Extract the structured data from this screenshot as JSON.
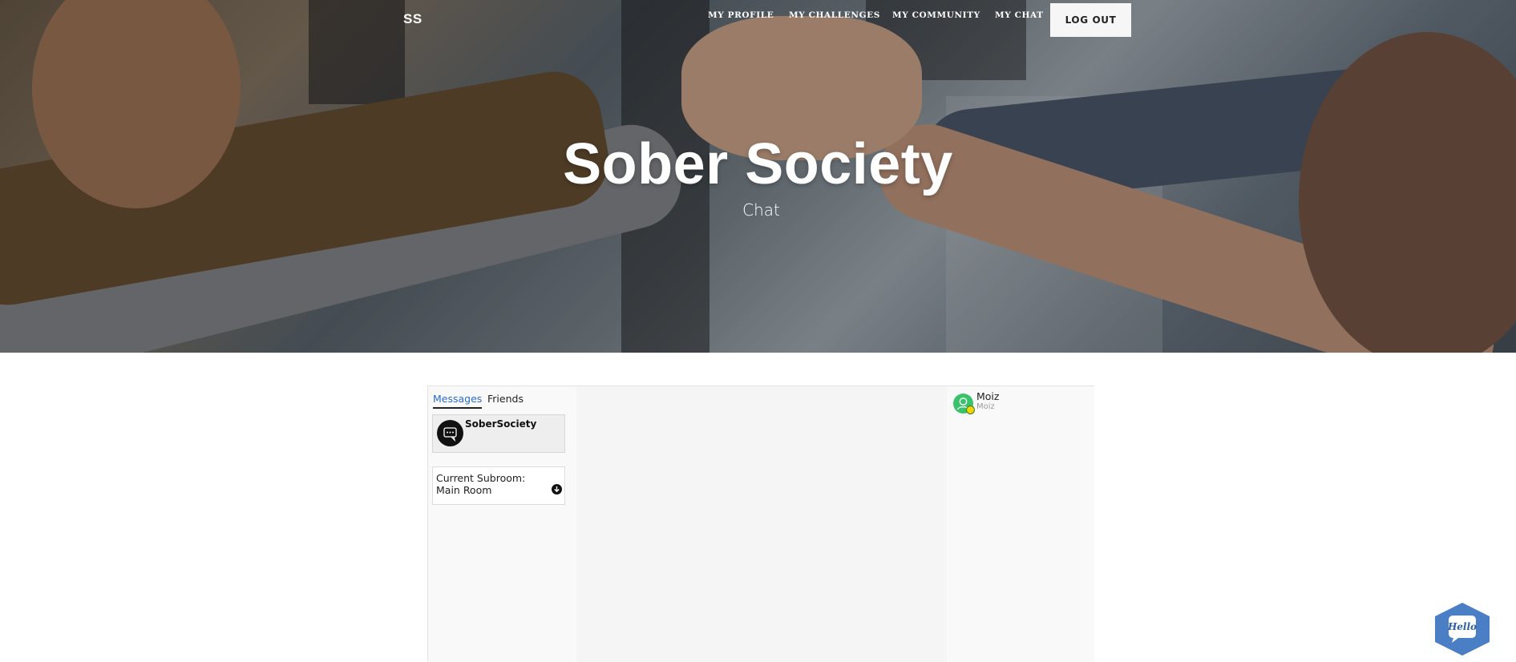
{
  "nav": {
    "brand": "SS",
    "links": [
      "MY PROFILE",
      "MY CHALLENGES",
      "MY COMMUNITY",
      "MY CHAT"
    ],
    "logout": "LOG OUT"
  },
  "hero": {
    "title": "Sober Society",
    "subtitle": "Chat"
  },
  "chat": {
    "tabs": {
      "messages": "Messages",
      "friends": "Friends"
    },
    "room": {
      "name": "SoberSociety"
    },
    "subroom": {
      "label": "Current Subroom:",
      "value": "Main Room"
    },
    "users": [
      {
        "name": "Moiz",
        "username": "Moiz"
      }
    ]
  },
  "hello_widget": {
    "label": "Hello"
  },
  "colors": {
    "active_tab": "#2a6bd1",
    "online_avatar": "#3ac26a",
    "status_dot": "#f1d400",
    "hello_badge": "#4a7fc6"
  }
}
